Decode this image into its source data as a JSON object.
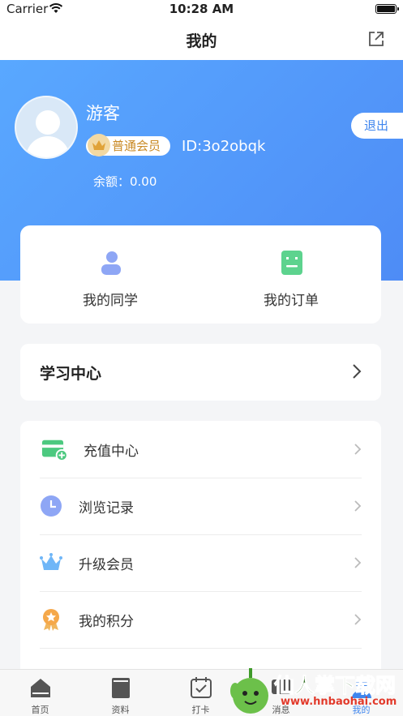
{
  "status_bar": {
    "carrier": "Carrier",
    "time": "10:28 AM"
  },
  "nav": {
    "title": "我的"
  },
  "profile": {
    "username": "游客",
    "member_level": "普通会员",
    "user_id": "ID:3o2obqk",
    "balance": "余额：0.00",
    "logout": "退出"
  },
  "quick": [
    {
      "label": "我的同学",
      "icon": "classmate-icon"
    },
    {
      "label": "我的订单",
      "icon": "order-icon"
    }
  ],
  "study_center": {
    "label": "学习中心"
  },
  "menu": [
    {
      "label": "充值中心",
      "icon": "wallet-add-icon"
    },
    {
      "label": "浏览记录",
      "icon": "clock-icon"
    },
    {
      "label": "升级会员",
      "icon": "crown-icon"
    },
    {
      "label": "我的积分",
      "icon": "medal-icon"
    }
  ],
  "tabs": [
    {
      "label": "首页",
      "icon": "home-icon"
    },
    {
      "label": "资料",
      "icon": "book-icon"
    },
    {
      "label": "打卡",
      "icon": "calendar-check-icon"
    },
    {
      "label": "消息",
      "icon": "message-icon"
    },
    {
      "label": "我的",
      "icon": "user-icon"
    }
  ],
  "watermark": {
    "text": "仙人掌下载网",
    "url": "www.hnbaohai.com"
  },
  "colors": {
    "accent": "#3f86ee",
    "hero_start": "#59a8ff",
    "hero_end": "#4e8cf6",
    "member_gold": "#c98a25"
  }
}
